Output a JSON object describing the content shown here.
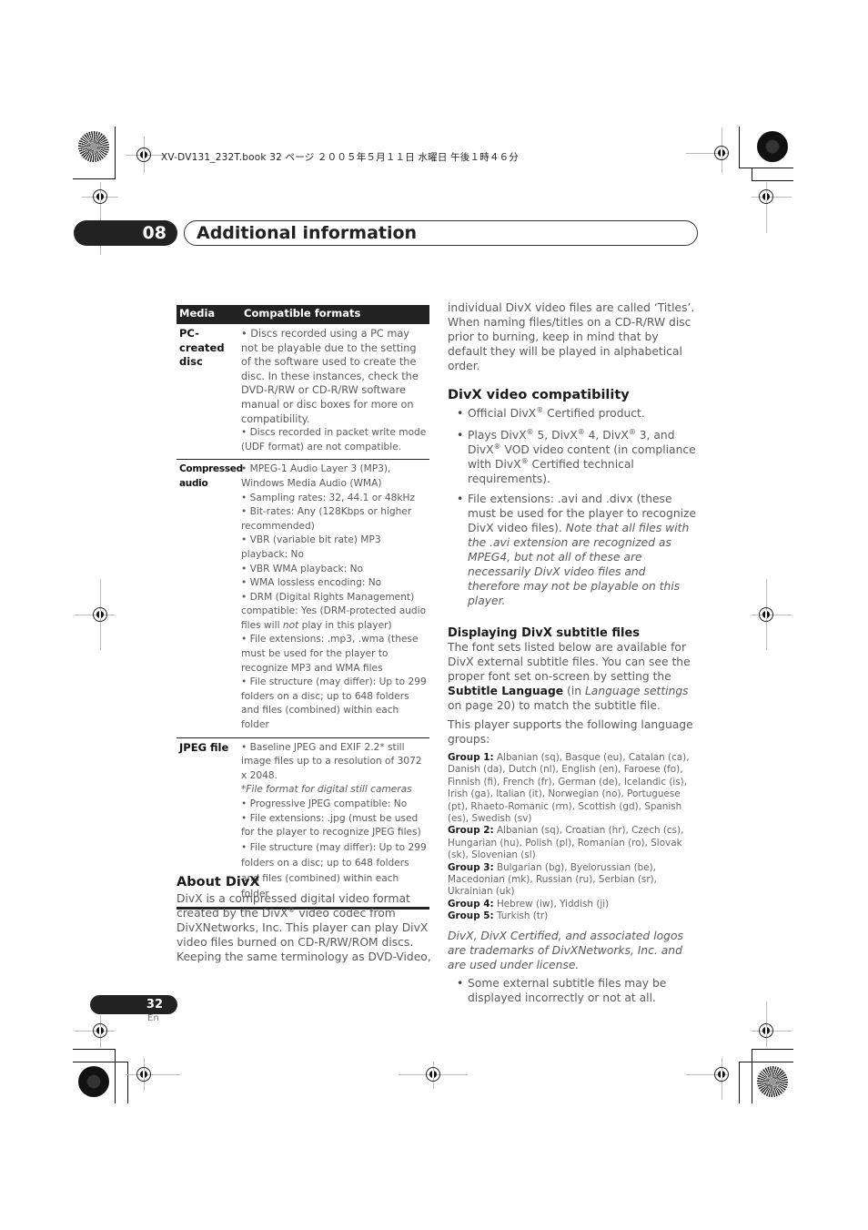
{
  "slug": "XV-DV131_232T.book  32 ページ  ２００５年５月１１日  水曜日  午後１時４６分",
  "chapter": {
    "number": "08",
    "title": "Additional information"
  },
  "table": {
    "headers": [
      "Media",
      "Compatible formats"
    ],
    "rows": [
      {
        "media": "PC-created disc",
        "items": [
          "• Discs recorded using a PC may not be playable due to the setting of the software used to create the disc. In these instances, check the DVD-R/RW or CD-R/RW software manual or disc boxes for more on compatibility.",
          "• Discs recorded in packet write mode (UDF format) are not compatible."
        ]
      },
      {
        "media": "Compressed audio",
        "items": [
          "• MPEG-1 Audio Layer 3 (MP3), Windows Media Audio (WMA)",
          "• Sampling rates: 32, 44.1 or 48kHz",
          "• Bit-rates: Any (128Kbps or higher recommended)",
          "• VBR (variable bit rate) MP3 playback: No",
          "• VBR WMA playback: No",
          "• WMA lossless encoding: No",
          "• DRM (Digital Rights Management) compatible: Yes (DRM-protected audio files will",
          "not",
          "play in this player)",
          "• File extensions: .mp3, .wma (these must be used for the player to recognize MP3 and WMA files",
          "• File structure (may differ): Up to 299 folders on a disc; up to 648 folders and files (combined) within each folder"
        ]
      },
      {
        "media": "JPEG file",
        "items": [
          "• Baseline JPEG and EXIF 2.2* still image files up to a resolution of 3072 x 2048.",
          "*File format for digital still cameras",
          "• Progressive JPEG compatible: No",
          "• File extensions: .jpg (must be used for the player to recognize JPEG files)",
          "• File structure (may differ): Up to 299 folders on a disc; up to 648 folders and files (combined) within each folder"
        ]
      }
    ]
  },
  "about_divx": {
    "heading": "About DivX",
    "text_a": "DivX is a compressed digital video format created by the DivX",
    "reg": "®",
    "text_b": " video codec from DivXNetworks, Inc. This player can play DivX video files burned on CD-R/RW/ROM discs. Keeping the same terminology as DVD-Video,"
  },
  "right_column": {
    "continuation": "individual DivX video files are called ‘Titles’. When naming files/titles on a CD-R/RW disc prior to burning, keep in mind that by default they will be played in alphabetical order.",
    "compat_heading": "DivX video compatibility",
    "compat_bullets": {
      "b1_a": "Official DivX",
      "b1_b": " Certified product.",
      "b2_a": "Plays DivX",
      "b2_b": " 5, DivX",
      "b2_c": " 4, DivX",
      "b2_d": " 3, and DivX",
      "b2_e": " VOD video content (in compliance with DivX",
      "b2_f": " Certified technical requirements).",
      "b3_a": "File extensions: .avi and .divx (these must be used for the player to recognize DivX video files). ",
      "b3_b": "Note that all files with the .avi extension are recognized as MPEG4, but not all of these are necessarily DivX video files and therefore may not be playable on this player.",
      "reg": "®"
    },
    "subtitle_heading": "Displaying DivX subtitle files",
    "subtitle_p1_a": "The font sets listed below are available for DivX external subtitle files. You can see the proper font set on-screen by setting the ",
    "subtitle_p1_bold": "Subtitle Language",
    "subtitle_p1_b": "  (in ",
    "subtitle_p1_it": "Language settings",
    "subtitle_p1_c": " on page 20) to match the subtitle file.",
    "subtitle_p2": "This player supports the following language groups:",
    "groups": [
      {
        "label": "Group 1:",
        "text": " Albanian (sq), Basque (eu), Catalan (ca), Danish (da), Dutch (nl), English (en), Faroese (fo), Finnish (fi), French (fr), German (de), Icelandic (is), Irish (ga), Italian (it), Norwegian (no), Portuguese (pt), Rhaeto-Romanic (rm), Scottish (gd), Spanish (es), Swedish (sv)"
      },
      {
        "label": "Group 2:",
        "text": " Albanian (sq), Croatian (hr), Czech (cs), Hungarian (hu), Polish (pl), Romanian (ro), Slovak (sk), Slovenian (sl)"
      },
      {
        "label": "Group 3:",
        "text": " Bulgarian (bg), Byelorussian (be), Macedonian (mk), Russian (ru), Serbian (sr), Ukrainian (uk)"
      },
      {
        "label": "Group 4:",
        "text": " Hebrew (iw), Yiddish (ji)"
      },
      {
        "label": "Group 5:",
        "text": " Turkish (tr)"
      }
    ],
    "trademark": "DivX, DivX Certified, and associated logos are trademarks of DivXNetworks, Inc. and are used under license.",
    "final_bullet": "Some external subtitle files may be displayed incorrectly or not at all."
  },
  "footer": {
    "page_number": "32",
    "language": "En"
  }
}
